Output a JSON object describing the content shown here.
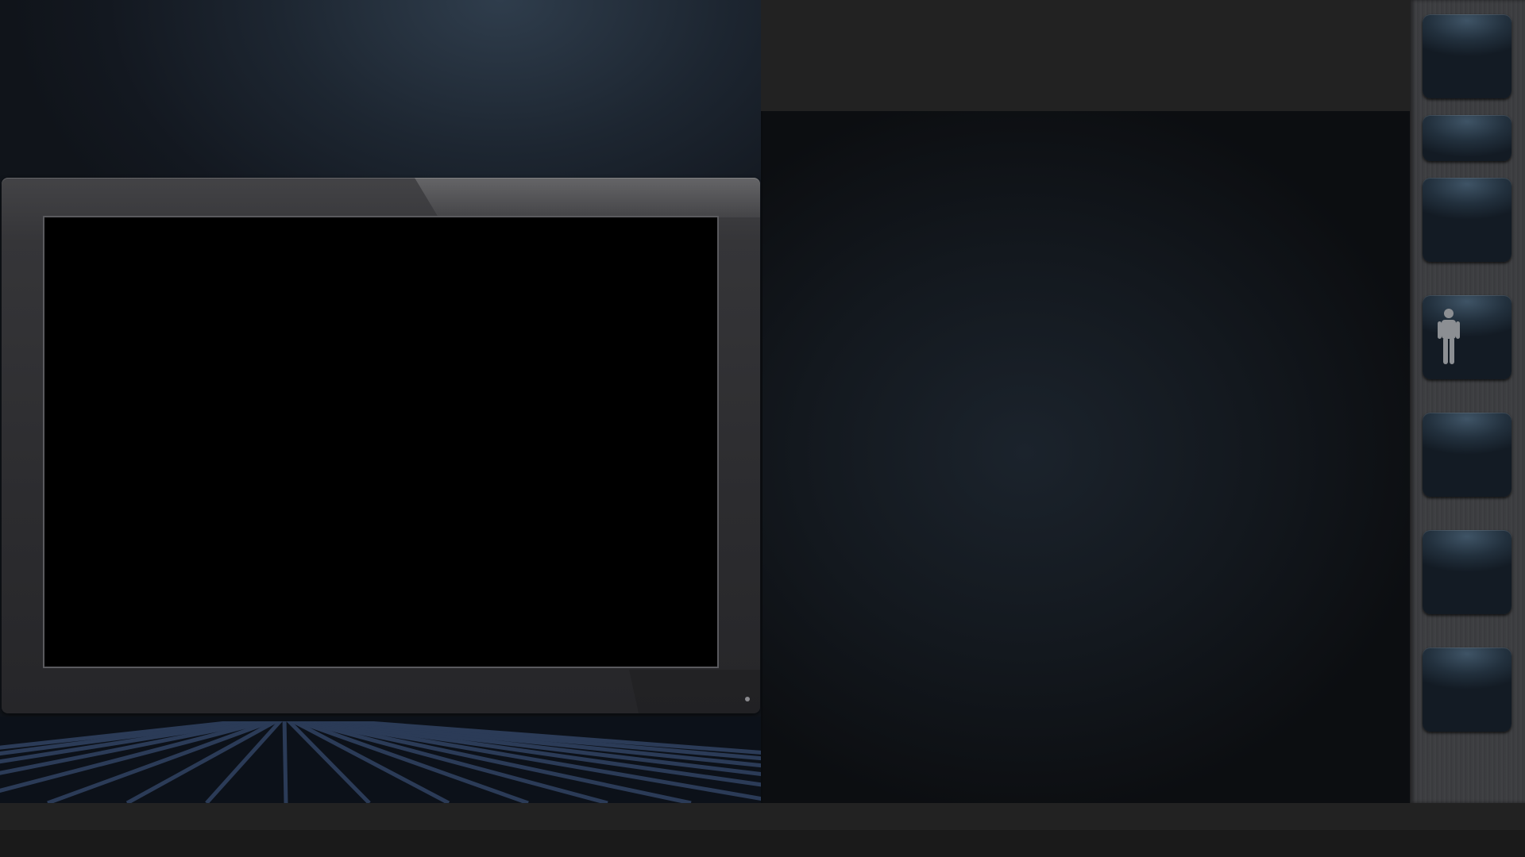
{
  "sidebar": {
    "buttons": [
      {
        "icon": ""
      },
      {
        "icon": ""
      },
      {
        "icon": ""
      },
      {
        "icon": "person-icon"
      },
      {
        "icon": ""
      },
      {
        "icon": ""
      },
      {
        "icon": ""
      }
    ]
  },
  "colors": {
    "background": "#141518",
    "screen": "#000000",
    "monitor_bezel": "#343437",
    "header_bar": "#222222",
    "sidebar": "#3d3e41",
    "button": "#22303d",
    "floor_lines": "#2a3a55"
  }
}
